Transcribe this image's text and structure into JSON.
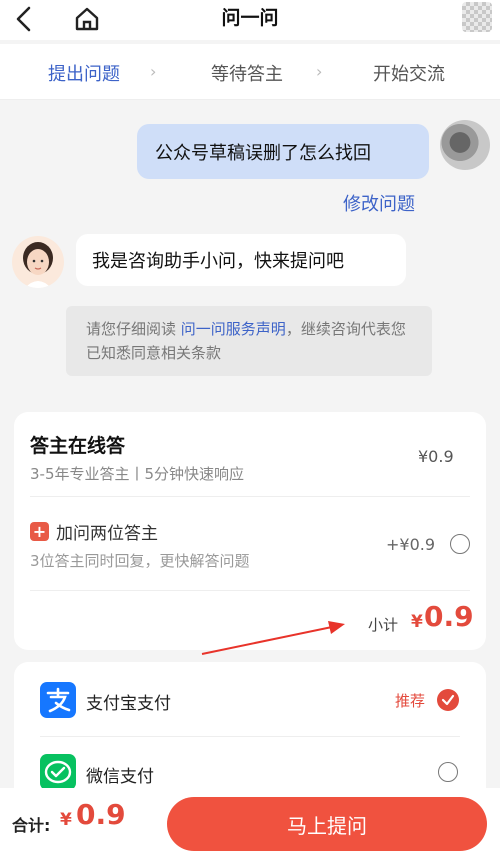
{
  "header": {
    "title": "问一问"
  },
  "steps": [
    "提出问题",
    "等待答主",
    "开始交流"
  ],
  "chat": {
    "user_question": "公众号草稿误删了怎么找回",
    "edit_link": "修改问题",
    "bot_message": "我是咨询助手小问，快来提问吧"
  },
  "notice": {
    "prefix": "请您仔细阅读",
    "link": "问一问服务声明",
    "suffix": "，继续咨询代表您已知悉同意相关条款"
  },
  "answer_service": {
    "title": "答主在线答",
    "subtitle": "3-5年专业答主丨5分钟快速响应",
    "price": "¥0.9",
    "addon_icon": "+",
    "addon_title": "加问两位答主",
    "addon_desc": "3位答主同时回复，更快解答问题",
    "addon_price": "+¥0.9",
    "subtotal_label": "小计",
    "subtotal_currency": "¥",
    "subtotal_value": "0.9"
  },
  "payment": {
    "alipay_label": "支付宝支付",
    "alipay_tag": "推荐",
    "wechat_label": "微信支付",
    "selected": "alipay"
  },
  "footer": {
    "total_label": "合计:",
    "total_currency": "¥",
    "total_value": "0.9",
    "submit_label": "马上提问"
  },
  "colors": {
    "accent_blue": "#3d63c8",
    "price_red": "#e34a3c",
    "button_red": "#f0523f",
    "alipay_blue": "#1677ff",
    "wechat_green": "#07c160"
  }
}
